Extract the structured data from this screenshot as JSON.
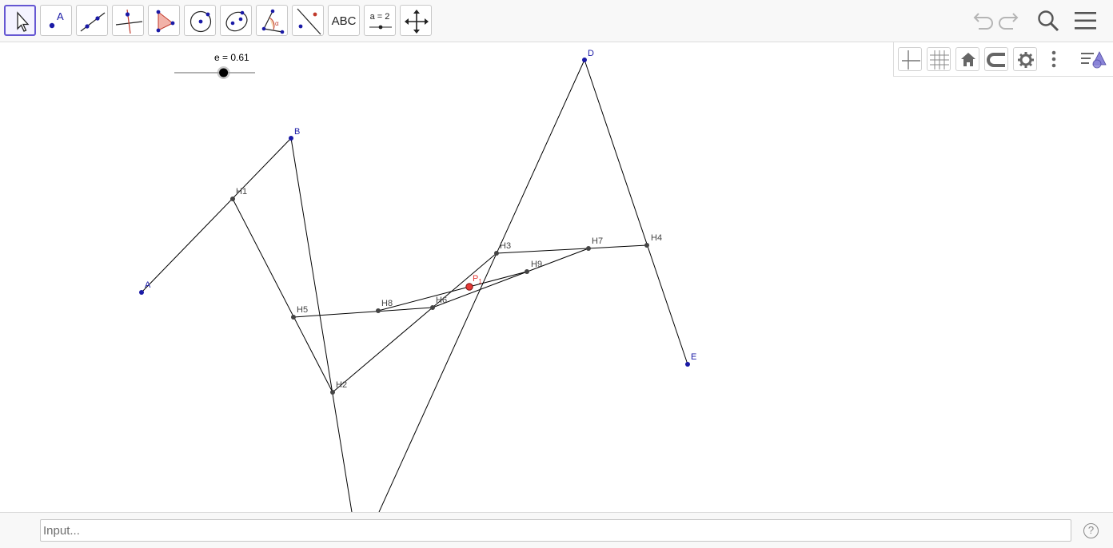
{
  "toolbar": {
    "tools": [
      {
        "name": "move-tool",
        "icon": "arrow-pointer-icon"
      },
      {
        "name": "point-tool",
        "icon": "point-icon",
        "letter": "A"
      },
      {
        "name": "line-tool",
        "icon": "line-through-points-icon"
      },
      {
        "name": "perpendicular-line-tool",
        "icon": "perpendicular-icon"
      },
      {
        "name": "polygon-tool",
        "icon": "polygon-icon"
      },
      {
        "name": "circle-tool",
        "icon": "circle-center-point-icon"
      },
      {
        "name": "ellipse-tool",
        "icon": "ellipse-icon"
      },
      {
        "name": "angle-tool",
        "icon": "angle-icon"
      },
      {
        "name": "reflect-tool",
        "icon": "reflect-about-line-icon"
      },
      {
        "name": "text-tool",
        "icon": "text-icon",
        "label": "ABC"
      },
      {
        "name": "slider-tool",
        "icon": "slider-icon",
        "label": "a = 2"
      },
      {
        "name": "move-graphics-view-tool",
        "icon": "move-arrows-icon"
      }
    ],
    "undo": "undo-icon",
    "redo": "redo-icon",
    "search": "search-icon",
    "menu": "hamburger-menu-icon"
  },
  "stylebar": {
    "buttons": [
      "axes-icon",
      "grid-icon",
      "home-icon",
      "point-capture-icon",
      "settings-gear-icon",
      "more-vertical-icon",
      "view-menu-icon"
    ]
  },
  "slider": {
    "label": "e = 0.61",
    "value": 0.61
  },
  "construction": {
    "points": {
      "A": {
        "label": "A"
      },
      "B": {
        "label": "B"
      },
      "D": {
        "label": "D"
      },
      "E": {
        "label": "E"
      },
      "H1": {
        "label": "H1"
      },
      "H2": {
        "label": "H2"
      },
      "H3": {
        "label": "H3"
      },
      "H4": {
        "label": "H4"
      },
      "H5": {
        "label": "H5"
      },
      "H6": {
        "label": "H6"
      },
      "H7": {
        "label": "H7"
      },
      "H8": {
        "label": "H8"
      },
      "H9": {
        "label": "H9"
      },
      "P1": {
        "label": "P",
        "subscript": "1"
      }
    },
    "colors": {
      "free_point": "#1a1aa6",
      "dependent_point": "#444444",
      "highlight_point": "#e53935",
      "line": "#000000"
    }
  },
  "inputbar": {
    "placeholder": "Input...",
    "help": "?"
  }
}
